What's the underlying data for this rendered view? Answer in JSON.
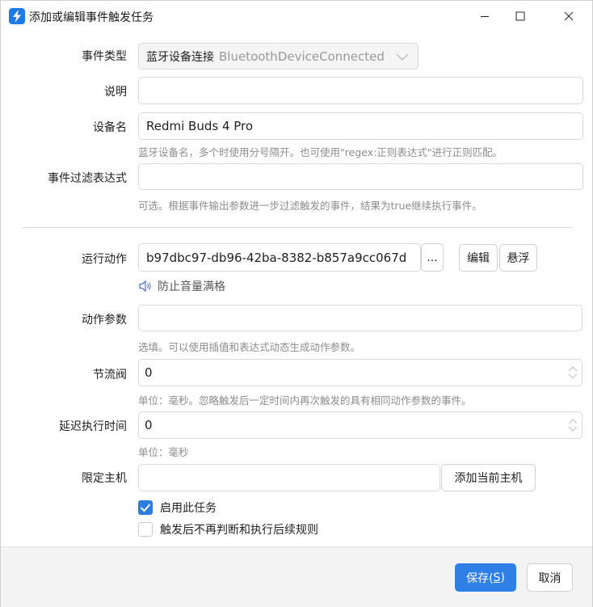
{
  "window": {
    "title": "添加或编辑事件触发任务"
  },
  "form": {
    "event_type": {
      "label": "事件类型",
      "value_cn": "蓝牙设备连接",
      "value_en": "BluetoothDeviceConnected"
    },
    "description": {
      "label": "说明",
      "value": ""
    },
    "device_name": {
      "label": "设备名",
      "value": "Redmi Buds 4 Pro",
      "hint": "蓝牙设备名，多个时使用分号隔开。也可使用\"regex:正则表达式\"进行正则匹配。"
    },
    "filter_expr": {
      "label": "事件过滤表达式",
      "value": "",
      "hint": "可选。根据事件输出参数进一步过滤触发的事件，结果为true继续执行事件。"
    },
    "action": {
      "label": "运行动作",
      "value": "b97dbc97-db96-42ba-8382-b857a9cc067d",
      "browse_label": "...",
      "edit_label": "编辑",
      "float_label": "悬浮",
      "action_name": "防止音量满格"
    },
    "action_params": {
      "label": "动作参数",
      "value": "",
      "hint": "选填。可以使用插值和表达式动态生成动作参数。"
    },
    "throttle": {
      "label": "节流阀",
      "value": "0",
      "hint": "单位：毫秒。忽略触发后一定时间内再次触发的具有相同动作参数的事件。"
    },
    "delay": {
      "label": "延迟执行时间",
      "value": "0",
      "hint": "单位：毫秒"
    },
    "host": {
      "label": "限定主机",
      "value": "",
      "add_label": "添加当前主机"
    },
    "enable": {
      "label": "启用此任务",
      "checked": true
    },
    "stop_after": {
      "label": "触发后不再判断和执行后续规则",
      "checked": false
    }
  },
  "footer": {
    "save_text": "保存(",
    "save_key": "S",
    "save_close": ")",
    "cancel_label": "取消"
  },
  "colors": {
    "accent": "#2f7fe6",
    "hint_text": "#8c8c8c",
    "border": "#d9d9d9"
  }
}
